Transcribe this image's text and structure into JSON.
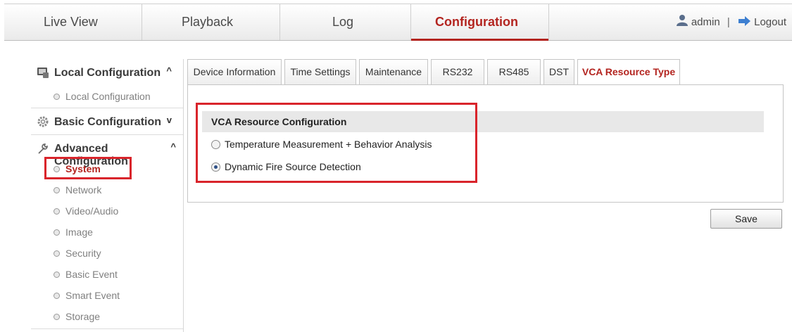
{
  "topnav": {
    "tabs": [
      {
        "label": "Live View"
      },
      {
        "label": "Playback"
      },
      {
        "label": "Log"
      },
      {
        "label": "Configuration"
      }
    ],
    "user": "admin",
    "logout": "Logout"
  },
  "sidebar": {
    "groups": [
      {
        "label": "Local Configuration",
        "icon": "monitor-icon",
        "chevron": "^"
      },
      {
        "label": "Basic Configuration",
        "icon": "gear-icon",
        "chevron": "v"
      },
      {
        "label": "Advanced Configuration",
        "icon": "wrench-icon",
        "chevron": "^"
      }
    ],
    "local_items": [
      "Local Configuration"
    ],
    "advanced_items": [
      "System",
      "Network",
      "Video/Audio",
      "Image",
      "Security",
      "Basic Event",
      "Smart Event",
      "Storage"
    ]
  },
  "tabs": [
    "Device Information",
    "Time Settings",
    "Maintenance",
    "RS232",
    "RS485",
    "DST",
    "VCA Resource Type"
  ],
  "section": {
    "title": "VCA Resource Configuration",
    "options": [
      {
        "label": "Temperature Measurement + Behavior Analysis",
        "selected": false
      },
      {
        "label": "Dynamic Fire Source Detection",
        "selected": true
      }
    ]
  },
  "save_label": "Save",
  "colors": {
    "accent": "#b3241f",
    "highlight_box": "#d9242b"
  }
}
